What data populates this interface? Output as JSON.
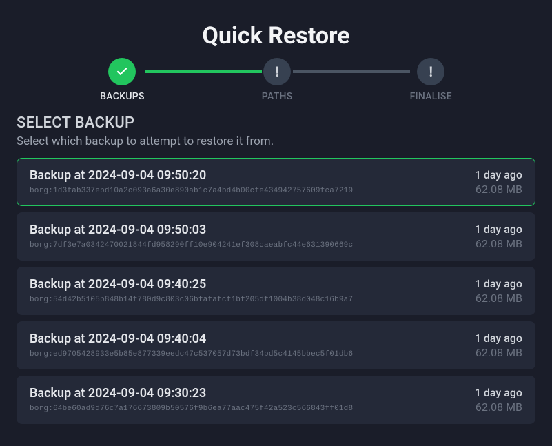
{
  "title": "Quick Restore",
  "stepper": {
    "steps": [
      {
        "label": "BACKUPS",
        "state": "done"
      },
      {
        "label": "PATHS",
        "state": "pending"
      },
      {
        "label": "FINALISE",
        "state": "pending"
      }
    ]
  },
  "section": {
    "title": "SELECT BACKUP",
    "subtitle": "Select which backup to attempt to restore it from."
  },
  "backups": [
    {
      "title": "Backup at 2024-09-04 09:50:20",
      "hash": "borg:1d3fab337ebd10a2c093a6a30e890ab1c7a4bd4b00cfe434942757609fca7219",
      "age": "1 day ago",
      "size": "62.08 MB",
      "selected": true
    },
    {
      "title": "Backup at 2024-09-04 09:50:03",
      "hash": "borg:7df3e7a0342470021844fd958290ff10e904241ef308caeabfc44e631390669c",
      "age": "1 day ago",
      "size": "62.08 MB",
      "selected": false
    },
    {
      "title": "Backup at 2024-09-04 09:40:25",
      "hash": "borg:54d42b5105b848b14f780d9c803c06bfafafcf1bf205df1004b38d048c16b9a7",
      "age": "1 day ago",
      "size": "62.08 MB",
      "selected": false
    },
    {
      "title": "Backup at 2024-09-04 09:40:04",
      "hash": "borg:ed9705428933e5b85e877339eedc47c537057d73bdf34bd5c4145bbec5f01db6",
      "age": "1 day ago",
      "size": "62.08 MB",
      "selected": false
    },
    {
      "title": "Backup at 2024-09-04 09:30:23",
      "hash": "borg:64be60ad9d76c7a176673809b50576f9b6ea77aac475f42a523c566843ff01d8",
      "age": "1 day ago",
      "size": "62.08 MB",
      "selected": false
    }
  ]
}
